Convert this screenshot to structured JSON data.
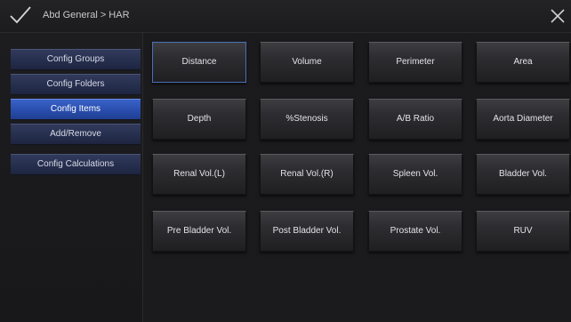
{
  "titlebar": {
    "title": "Abd General > HAR",
    "check_icon": "checkmark-icon",
    "close_icon": "close-icon"
  },
  "sidebar": {
    "items": [
      {
        "label": "Config Groups",
        "active": false
      },
      {
        "label": "Config Folders",
        "active": false
      },
      {
        "label": "Config Items",
        "active": true
      },
      {
        "label": "Add/Remove",
        "active": false
      },
      {
        "label": "Config Calculations",
        "active": false
      }
    ]
  },
  "grid": {
    "items": [
      {
        "label": "Distance",
        "selected": true
      },
      {
        "label": "Volume",
        "selected": false
      },
      {
        "label": "Perimeter",
        "selected": false
      },
      {
        "label": "Area",
        "selected": false
      },
      {
        "label": "Depth",
        "selected": false
      },
      {
        "label": "%Stenosis",
        "selected": false
      },
      {
        "label": "A/B Ratio",
        "selected": false
      },
      {
        "label": "Aorta Diameter",
        "selected": false
      },
      {
        "label": "Renal Vol.(L)",
        "selected": false
      },
      {
        "label": "Renal Vol.(R)",
        "selected": false
      },
      {
        "label": "Spleen Vol.",
        "selected": false
      },
      {
        "label": "Bladder Vol.",
        "selected": false
      },
      {
        "label": "Pre Bladder Vol.",
        "selected": false
      },
      {
        "label": "Post Bladder Vol.",
        "selected": false
      },
      {
        "label": "Prostate Vol.",
        "selected": false
      },
      {
        "label": "RUV",
        "selected": false
      }
    ]
  },
  "colors": {
    "accent": "#2a4fb0",
    "background": "#1b1b1d"
  }
}
